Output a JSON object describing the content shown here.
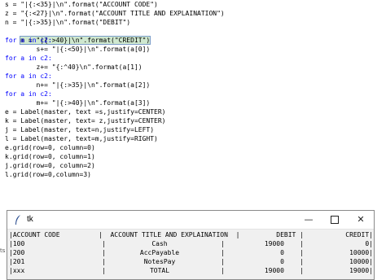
{
  "editor": {
    "lines": [
      "s = \"|{:<35}|\\n\".format(\"ACCOUNT CODE\")",
      "z = \"{:<27}|\\n\".format(\"ACCOUNT TITLE AND EXPLAINATION\")",
      "n = \"|{:>35}|\\n\".format(\"DEBIT\")",
      "m = \"|{:>40}|\\n\".format(\"CREDIT\")",
      "for a in c2:",
      "        s+= \"|{:<50}|\\n\".format(a[0])",
      "for a in c2:",
      "        z+= \"{:^40}\\n\".format(a[1])",
      "for a in c2:",
      "        n+= \"|{:>35}|\\n\".format(a[2])",
      "for a in c2:",
      "        m+= \"|{:>40}|\\n\".format(a[3])",
      "e = Label(master, text =s,justify=CENTER)",
      "k = Label(master, text= z,justify=CENTER)",
      "j = Label(master, text=n,justify=LEFT)",
      "l = Label(master, text=m,justify=RIGHT)",
      "e.grid(row=0, column=0)",
      "k.grid(row=0, column=1)",
      "j.grid(row=0, column=2)",
      "l.grid(row=0,column=3)"
    ]
  },
  "side_stub": "ts",
  "tk_window": {
    "title": "tk",
    "minimize": "—",
    "close": "✕",
    "headers": [
      "|ACCOUNT CODE",
      "|  ACCOUNT TITLE AND EXPLAINATION  |",
      "DEBIT |",
      "CREDIT|"
    ],
    "rows": [
      [
        "|100",
        "Cash",
        "19000    |",
        "0|"
      ],
      [
        "|200",
        "AccPayable",
        "0    |",
        "10000|"
      ],
      [
        "|201",
        "NotesPay",
        "0    |",
        "10000|"
      ],
      [
        "|xxx",
        "TOTAL",
        "19000    |",
        "19000|"
      ]
    ],
    "pipes": [
      "|",
      "|",
      "|",
      "|",
      "|"
    ]
  }
}
